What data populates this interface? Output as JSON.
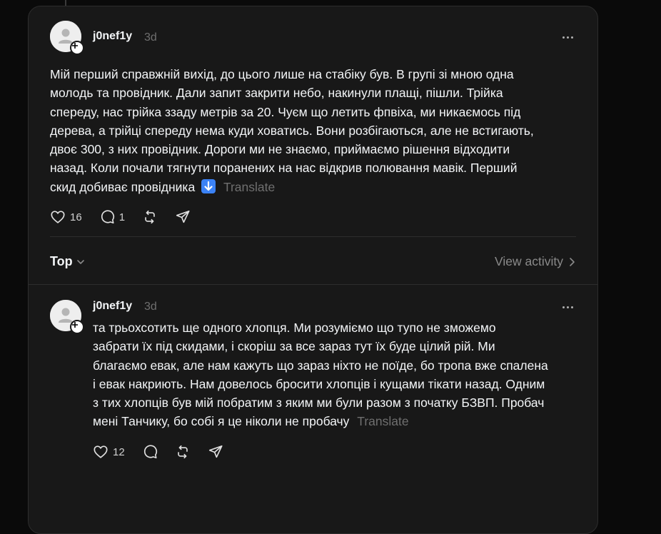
{
  "post": {
    "username": "j0nef1y",
    "time": "3d",
    "lines": [
      "Мій перший справжній вихід, до цього лише на стабіку був. В групі зі мною одна",
      "молодь та провідник. Дали запит закрити небо, накинули плащі, пішли. Трійка",
      "спереду, нас трійка ззаду метрів за 20. Чуєм що летить фпвіха, ми никаємось під",
      "дерева, а трійці спереду нема куди ховатись. Вони розбігаються, але не встигають,",
      "двоє 300, з них провідник. Дороги ми не знаємо, приймаємо рішення відходити",
      "назад. Коли почали тягнути поранених на нас відкрив полювання мавік. Перший",
      "скид добиває провідника"
    ],
    "translate": "Translate",
    "likes": "16",
    "replies": "1"
  },
  "sort": {
    "label": "Top"
  },
  "view_activity": "View activity",
  "reply": {
    "username": "j0nef1y",
    "time": "3d",
    "lines": [
      "та трьохсотить ще одного хлопця. Ми розуміємо що тупо не зможемо",
      "забрати їх під скидами, і скоріш за все зараз тут їх буде цілий рій. Ми",
      "благаємо евак, але нам кажуть що зараз ніхто не поїде, бо тропа вже спалена",
      "і евак накриють. Нам довелось бросити хлопців і кущами тікати назад. Одним",
      "з тих хлопців був мій побратим з яким ми були разом з початку БЗВП. Пробач",
      "мені Танчику, бо собі я це ніколи не пробачу"
    ],
    "translate": "Translate",
    "likes": "12"
  },
  "icons": {
    "heart": "heart-icon",
    "comment": "comment-icon",
    "repost": "repost-icon",
    "share": "share-icon",
    "more": "more-icon",
    "chevron": "chevron-down-icon",
    "arrow_emoji": "down-arrow-emoji-icon"
  },
  "colors": {
    "background": "#0a0a0a",
    "card": "#181818",
    "muted": "#6f6f6f",
    "text": "#f3f5f7",
    "emoji": "#3b82f6"
  }
}
